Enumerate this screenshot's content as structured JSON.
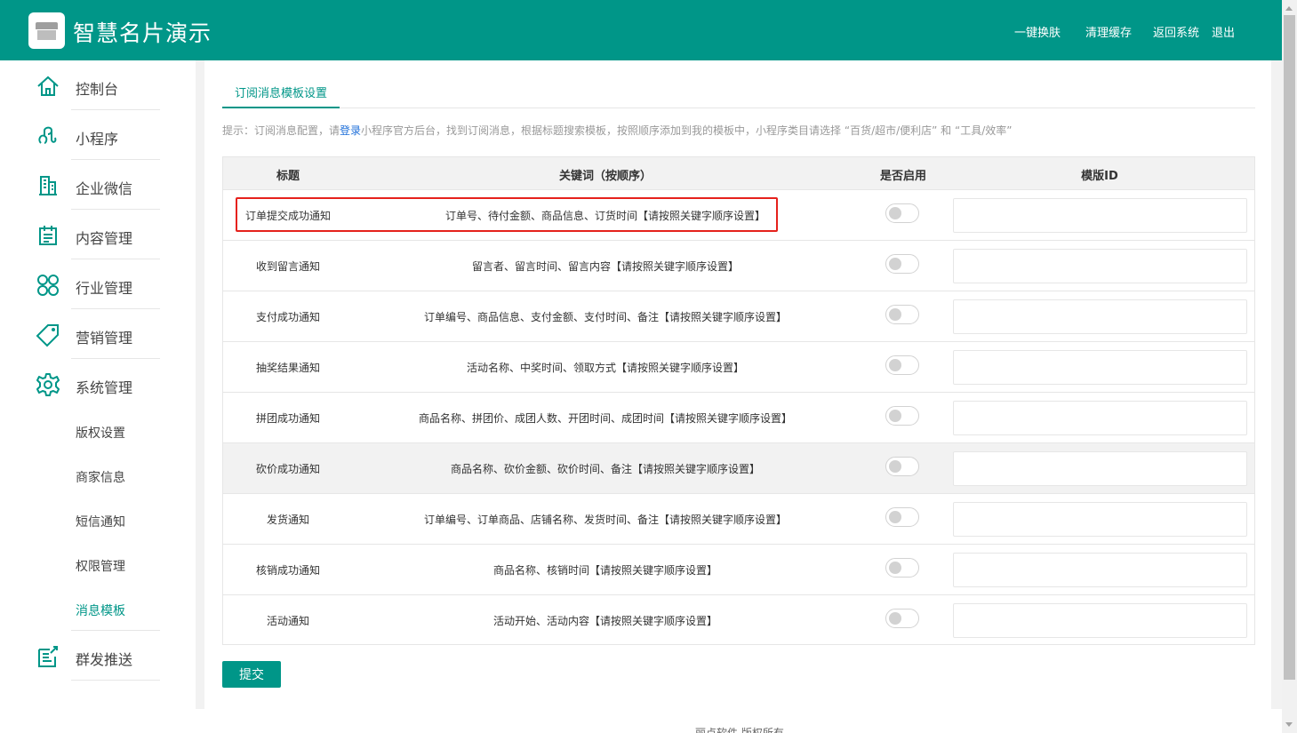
{
  "header": {
    "title": "智慧名片演示",
    "nav": [
      "一键换肤",
      "清理缓存",
      "返回系统",
      "退出"
    ]
  },
  "sidebar": {
    "items": [
      {
        "label": "控制台",
        "icon": "home-icon"
      },
      {
        "label": "小程序",
        "icon": "mini-program-icon"
      },
      {
        "label": "企业微信",
        "icon": "building-icon"
      },
      {
        "label": "内容管理",
        "icon": "clipboard-icon"
      },
      {
        "label": "行业管理",
        "icon": "grid-icon"
      },
      {
        "label": "营销管理",
        "icon": "tag-icon"
      },
      {
        "label": "系统管理",
        "icon": "gear-icon"
      },
      {
        "label": "群发推送",
        "icon": "edit-icon"
      }
    ],
    "sub_items": [
      "版权设置",
      "商家信息",
      "短信通知",
      "权限管理",
      "消息模板"
    ],
    "active_sub": "消息模板"
  },
  "tabs": {
    "active": "订阅消息模板设置"
  },
  "tip": {
    "prefix": "提示：订阅消息配置，请",
    "link": "登录",
    "suffix": "小程序官方后台，找到订阅消息，根据标题搜索模板，按照顺序添加到我的模板中，小程序类目请选择 “百货/超市/便利店” 和 “工具/效率”"
  },
  "table": {
    "headers": [
      "标题",
      "关键词（按顺序）",
      "是否启用",
      "模版ID"
    ],
    "rows": [
      {
        "title": "订单提交成功通知",
        "keywords": "订单号、待付金额、商品信息、订货时间【请按照关键字顺序设置】",
        "enabled": false,
        "template_id": ""
      },
      {
        "title": "收到留言通知",
        "keywords": "留言者、留言时间、留言内容【请按照关键字顺序设置】",
        "enabled": false,
        "template_id": ""
      },
      {
        "title": "支付成功通知",
        "keywords": "订单编号、商品信息、支付金额、支付时间、备注【请按照关键字顺序设置】",
        "enabled": false,
        "template_id": ""
      },
      {
        "title": "抽奖结果通知",
        "keywords": "活动名称、中奖时间、领取方式【请按照关键字顺序设置】",
        "enabled": false,
        "template_id": ""
      },
      {
        "title": "拼团成功通知",
        "keywords": "商品名称、拼团价、成团人数、开团时间、成团时间【请按照关键字顺序设置】",
        "enabled": false,
        "template_id": ""
      },
      {
        "title": "砍价成功通知",
        "keywords": "商品名称、砍价金额、砍价时间、备注【请按照关键字顺序设置】",
        "enabled": false,
        "template_id": ""
      },
      {
        "title": "发货通知",
        "keywords": "订单编号、订单商品、店铺名称、发货时间、备注【请按照关键字顺序设置】",
        "enabled": false,
        "template_id": ""
      },
      {
        "title": "核销成功通知",
        "keywords": "商品名称、核销时间【请按照关键字顺序设置】",
        "enabled": false,
        "template_id": ""
      },
      {
        "title": "活动通知",
        "keywords": "活动开始、活动内容【请按照关键字顺序设置】",
        "enabled": false,
        "template_id": ""
      }
    ]
  },
  "submit_label": "提交",
  "footer": "丽点软件 版权所有",
  "colors": {
    "primary": "#009688",
    "highlight_border": "#e5211c",
    "link": "#1e6fd9"
  }
}
